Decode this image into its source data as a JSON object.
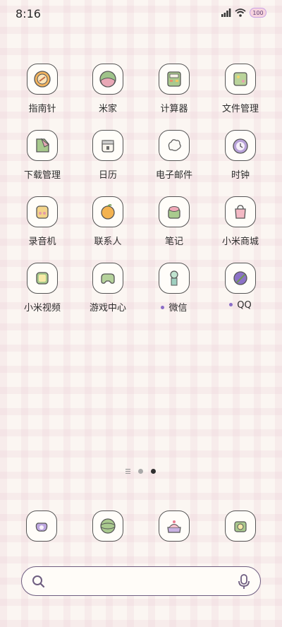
{
  "status_bar": {
    "time": "8:16",
    "battery": "100"
  },
  "apps": [
    [
      {
        "label": "指南针",
        "icon": "compass-icon"
      },
      {
        "label": "米家",
        "icon": "mijia-icon"
      },
      {
        "label": "计算器",
        "icon": "calculator-icon"
      },
      {
        "label": "文件管理",
        "icon": "file-manager-icon"
      }
    ],
    [
      {
        "label": "下载管理",
        "icon": "download-icon"
      },
      {
        "label": "日历",
        "icon": "calendar-icon"
      },
      {
        "label": "电子邮件",
        "icon": "email-icon"
      },
      {
        "label": "时钟",
        "icon": "clock-icon"
      }
    ],
    [
      {
        "label": "录音机",
        "icon": "recorder-icon"
      },
      {
        "label": "联系人",
        "icon": "contacts-icon"
      },
      {
        "label": "笔记",
        "icon": "notes-icon"
      },
      {
        "label": "小米商城",
        "icon": "mi-store-icon"
      }
    ],
    [
      {
        "label": "小米视频",
        "icon": "mi-video-icon"
      },
      {
        "label": "游戏中心",
        "icon": "game-center-icon"
      },
      {
        "label": "微信",
        "icon": "wechat-icon",
        "new_dot": true
      },
      {
        "label": "QQ",
        "icon": "qq-icon",
        "new_dot": true
      }
    ]
  ],
  "page_indicator": {
    "pages": 2,
    "active": 2
  },
  "dock": [
    {
      "icon": "phone-icon"
    },
    {
      "icon": "browser-icon"
    },
    {
      "icon": "gallery-icon"
    },
    {
      "icon": "camera-icon"
    }
  ],
  "colors": {
    "accent": "#8a6cc6",
    "icon_outline": "#555555",
    "search_border": "#6e5d80"
  }
}
